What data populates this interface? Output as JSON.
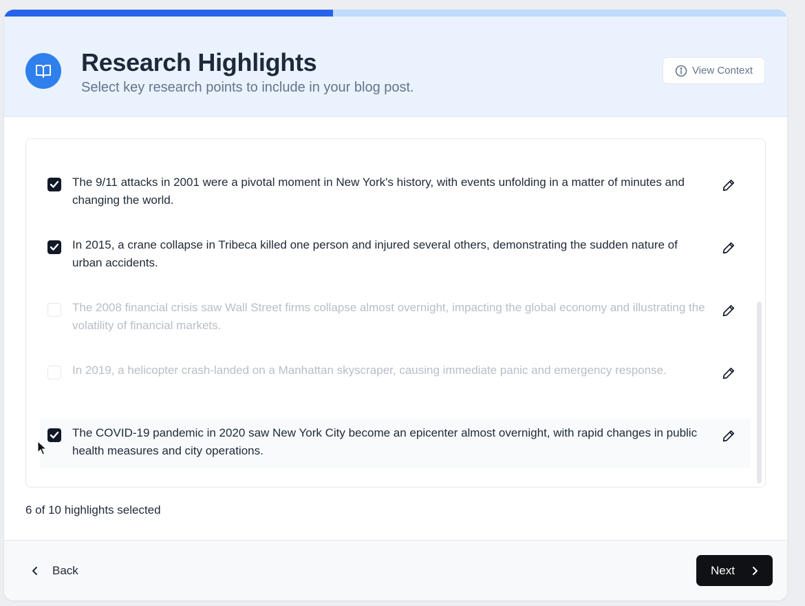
{
  "progress": {
    "fraction": 0.42,
    "fill_color": "#2563eb",
    "track_color": "#bfdbfe"
  },
  "header": {
    "title": "Research Highlights",
    "subtitle": "Select key research points to include in your blog post.",
    "icon": "book-open-icon",
    "icon_bg": "#2f80ed",
    "view_context_label": "View Context",
    "view_context_icon": "info-icon"
  },
  "highlights": [
    {
      "text": "The 9/11 attacks in 2001 were a pivotal moment in New York's history, with events unfolding in a matter of minutes and changing the world.",
      "checked": true
    },
    {
      "text": "In 2015, a crane collapse in Tribeca killed one person and injured several others, demonstrating the sudden nature of urban accidents.",
      "checked": true
    },
    {
      "text": "The 2008 financial crisis saw Wall Street firms collapse almost overnight, impacting the global economy and illustrating the volatility of financial markets.",
      "checked": false
    },
    {
      "text": "In 2019, a helicopter crash-landed on a Manhattan skyscraper, causing immediate panic and emergency response.",
      "checked": false
    },
    {
      "text": "The COVID-19 pandemic in 2020 saw New York City become an epicenter almost overnight, with rapid changes in public health measures and city operations.",
      "checked": true
    }
  ],
  "selection_summary": "6 of 10 highlights selected",
  "footer": {
    "back_label": "Back",
    "next_label": "Next"
  }
}
